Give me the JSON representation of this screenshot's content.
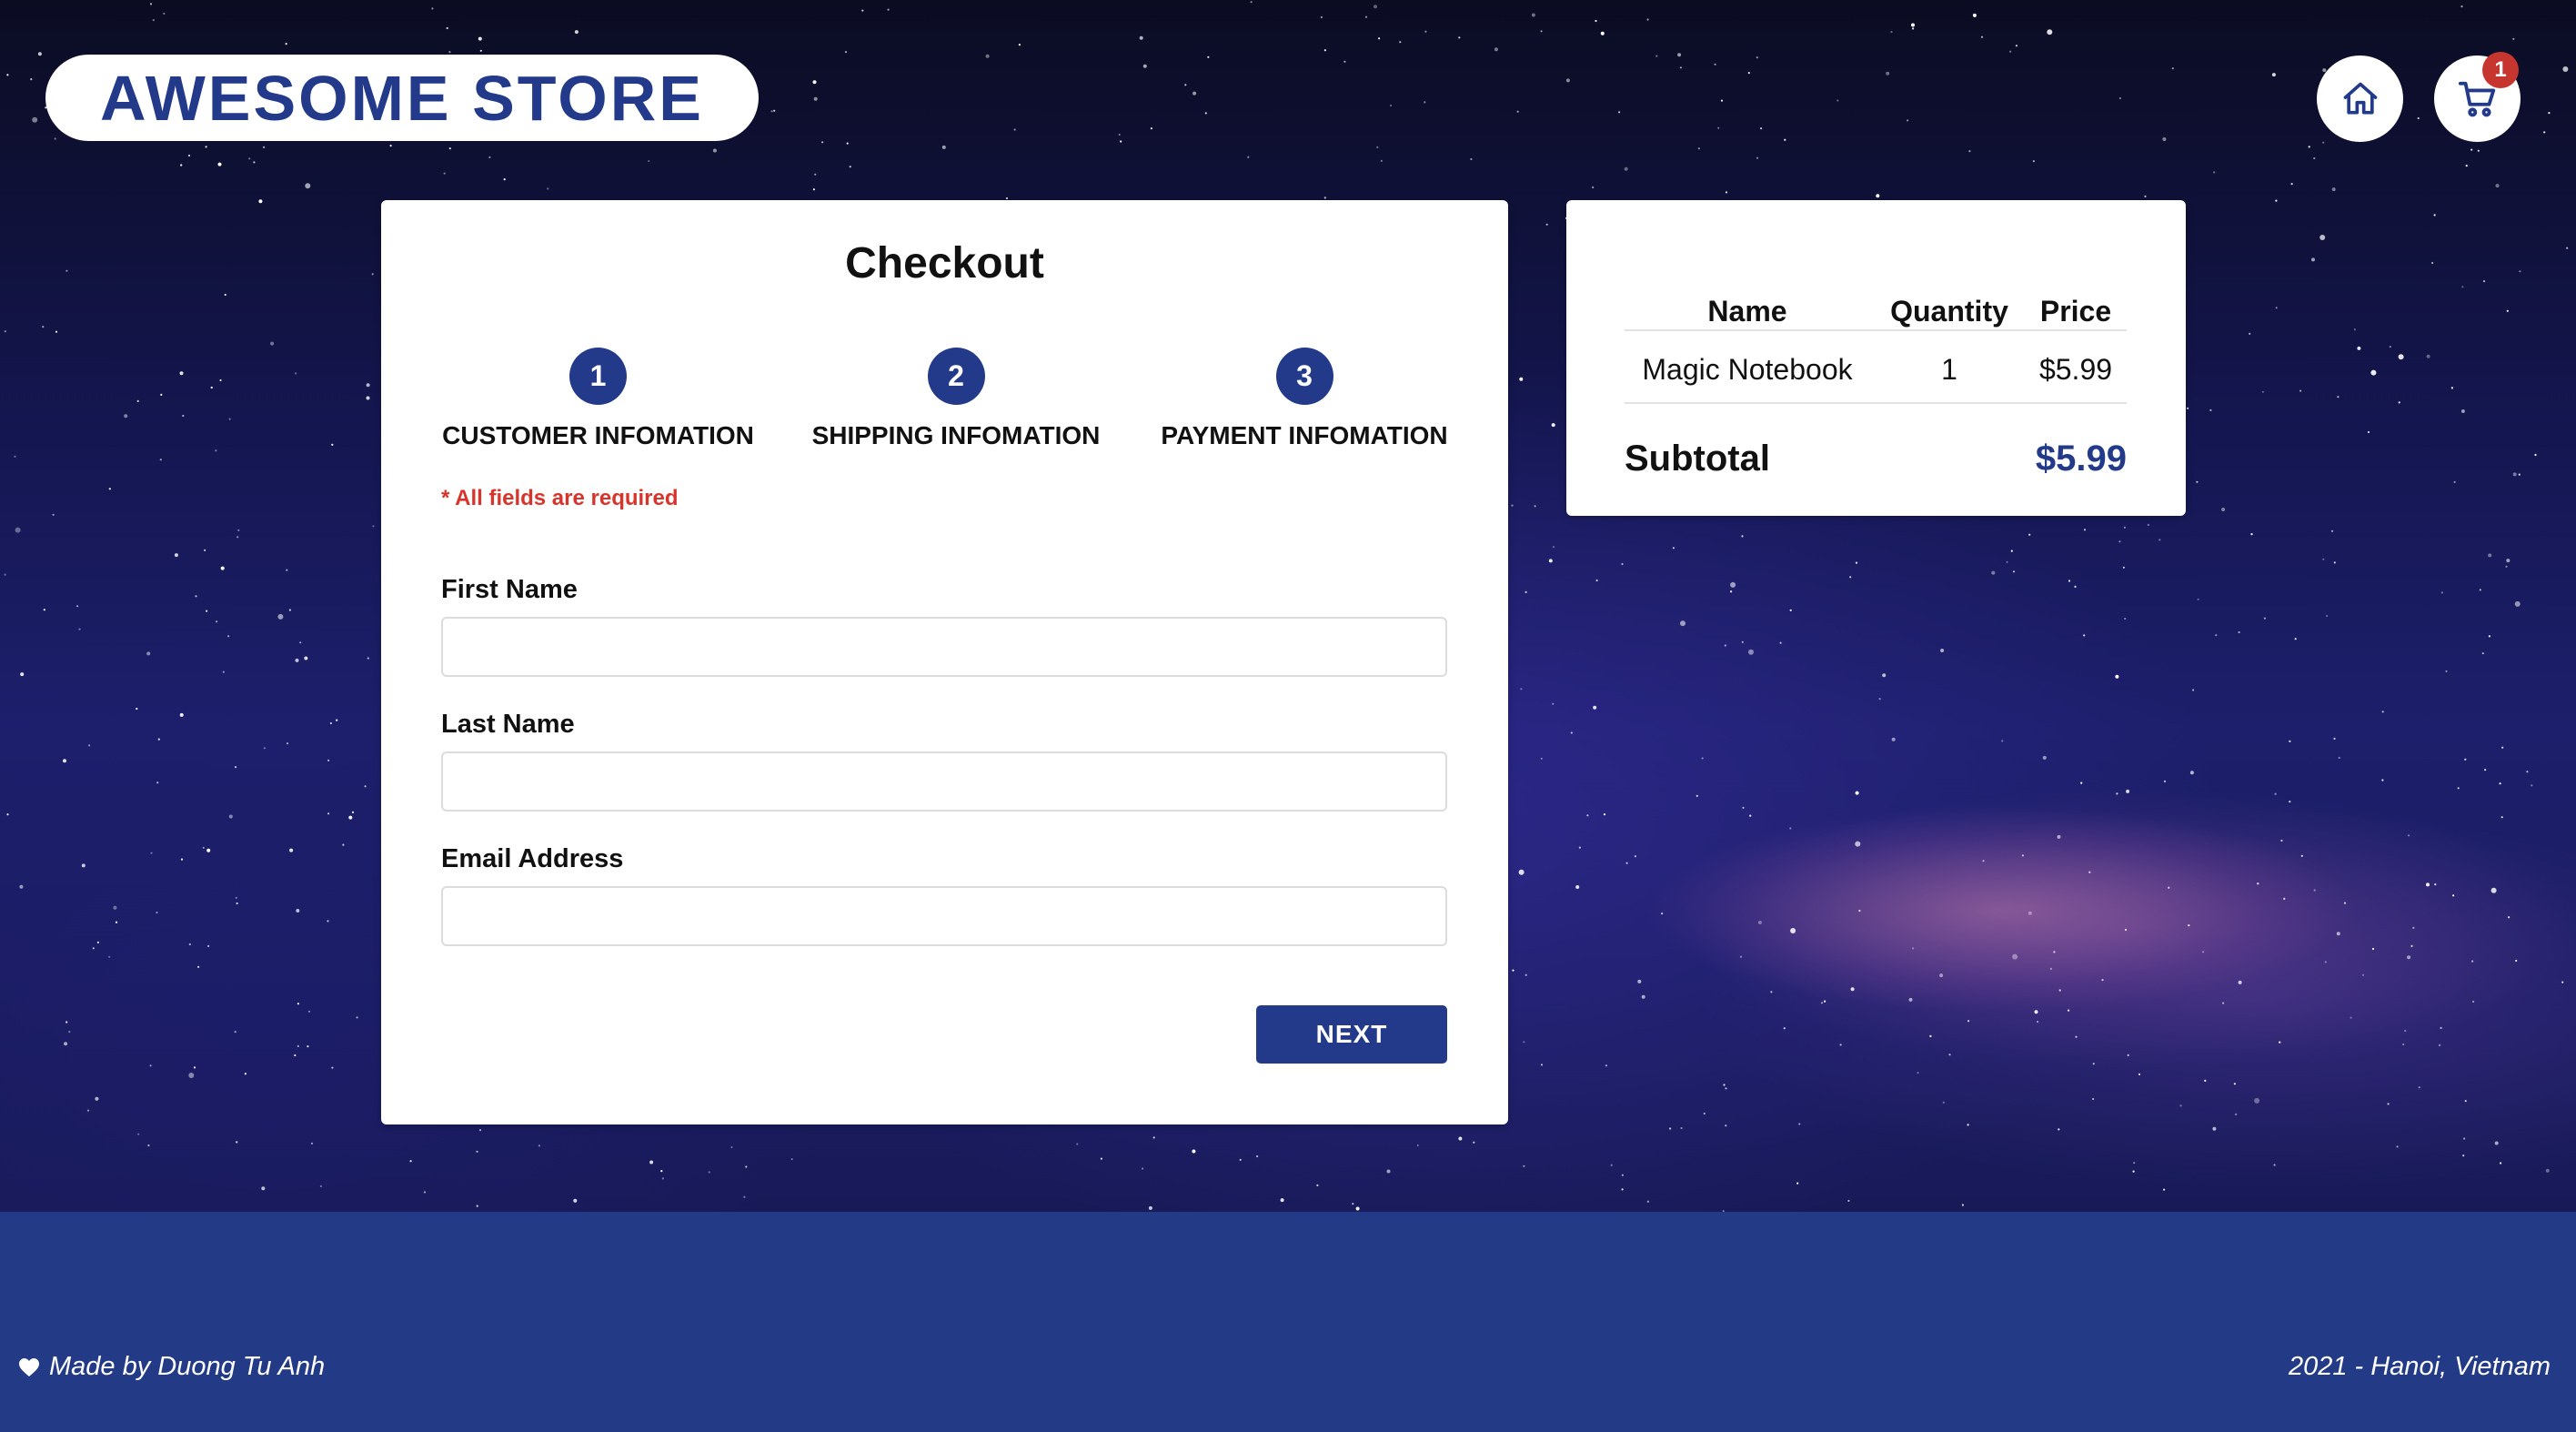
{
  "header": {
    "brand": "AWESOME STORE",
    "home_icon": "home-icon",
    "cart_icon": "cart-icon",
    "cart_count": "1"
  },
  "checkout": {
    "title": "Checkout",
    "steps": [
      {
        "number": "1",
        "label": "CUSTOMER INFOMATION"
      },
      {
        "number": "2",
        "label": "SHIPPING INFOMATION"
      },
      {
        "number": "3",
        "label": "PAYMENT INFOMATION"
      }
    ],
    "required_note": "* All fields are required",
    "fields": [
      {
        "label": "First Name",
        "value": ""
      },
      {
        "label": "Last Name",
        "value": ""
      },
      {
        "label": "Email Address",
        "value": ""
      }
    ],
    "next_label": "NEXT"
  },
  "summary": {
    "columns": [
      "Name",
      "Quantity",
      "Price"
    ],
    "rows": [
      {
        "name": "Magic Notebook",
        "quantity": "1",
        "price": "$5.99"
      }
    ],
    "subtotal_label": "Subtotal",
    "subtotal_value": "$5.99"
  },
  "footer": {
    "left": "Made by Duong Tu Anh",
    "right": "2021 - Hanoi, Vietnam"
  },
  "colors": {
    "brand": "#233a8a",
    "required": "#d9342b",
    "badge": "#c7352f",
    "footer": "#233a87"
  }
}
